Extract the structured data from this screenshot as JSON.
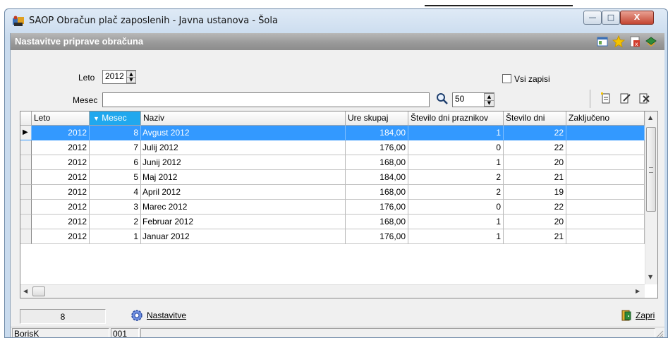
{
  "window": {
    "title": "SAOP Obračun plač zaposlenih - Javna ustanova - Šola",
    "buttons": {
      "minimize": "—",
      "maximize": "□",
      "close": "X"
    }
  },
  "panel": {
    "title": "Nastavitve priprave obračuna"
  },
  "filters": {
    "leto_label": "Leto",
    "leto_value": "2012",
    "vsi_zapisi_label": "Vsi zapisi",
    "vsi_zapisi_checked": false,
    "mesec_label": "Mesec",
    "mesec_value": "",
    "page_size": "50"
  },
  "grid": {
    "columns": [
      "Leto",
      "Mesec",
      "Naziv",
      "Ure skupaj",
      "Število dni praznikov",
      "Število dni",
      "Zaključeno"
    ],
    "sorted_column": "Mesec",
    "selected_row": 0,
    "rows": [
      [
        "2012",
        "8",
        "Avgust 2012",
        "184,00",
        "1",
        "22",
        ""
      ],
      [
        "2012",
        "7",
        "Julij 2012",
        "176,00",
        "0",
        "22",
        ""
      ],
      [
        "2012",
        "6",
        "Junij 2012",
        "168,00",
        "1",
        "20",
        ""
      ],
      [
        "2012",
        "5",
        "Maj 2012",
        "184,00",
        "2",
        "21",
        ""
      ],
      [
        "2012",
        "4",
        "April 2012",
        "168,00",
        "2",
        "19",
        ""
      ],
      [
        "2012",
        "3",
        "Marec 2012",
        "176,00",
        "0",
        "22",
        ""
      ],
      [
        "2012",
        "2",
        "Februar 2012",
        "168,00",
        "1",
        "20",
        ""
      ],
      [
        "2012",
        "1",
        "Januar 2012",
        "176,00",
        "1",
        "21",
        ""
      ]
    ]
  },
  "footer": {
    "record_count": "8",
    "settings_label": "Nastavitve",
    "close_label": "Zapri"
  },
  "statusbar": {
    "user": "BorisK",
    "code": "001",
    "extra": ""
  },
  "colors": {
    "selection": "#3399ff",
    "sorted_header": "#20a8ee",
    "header_bar": "#9a9a9a"
  }
}
